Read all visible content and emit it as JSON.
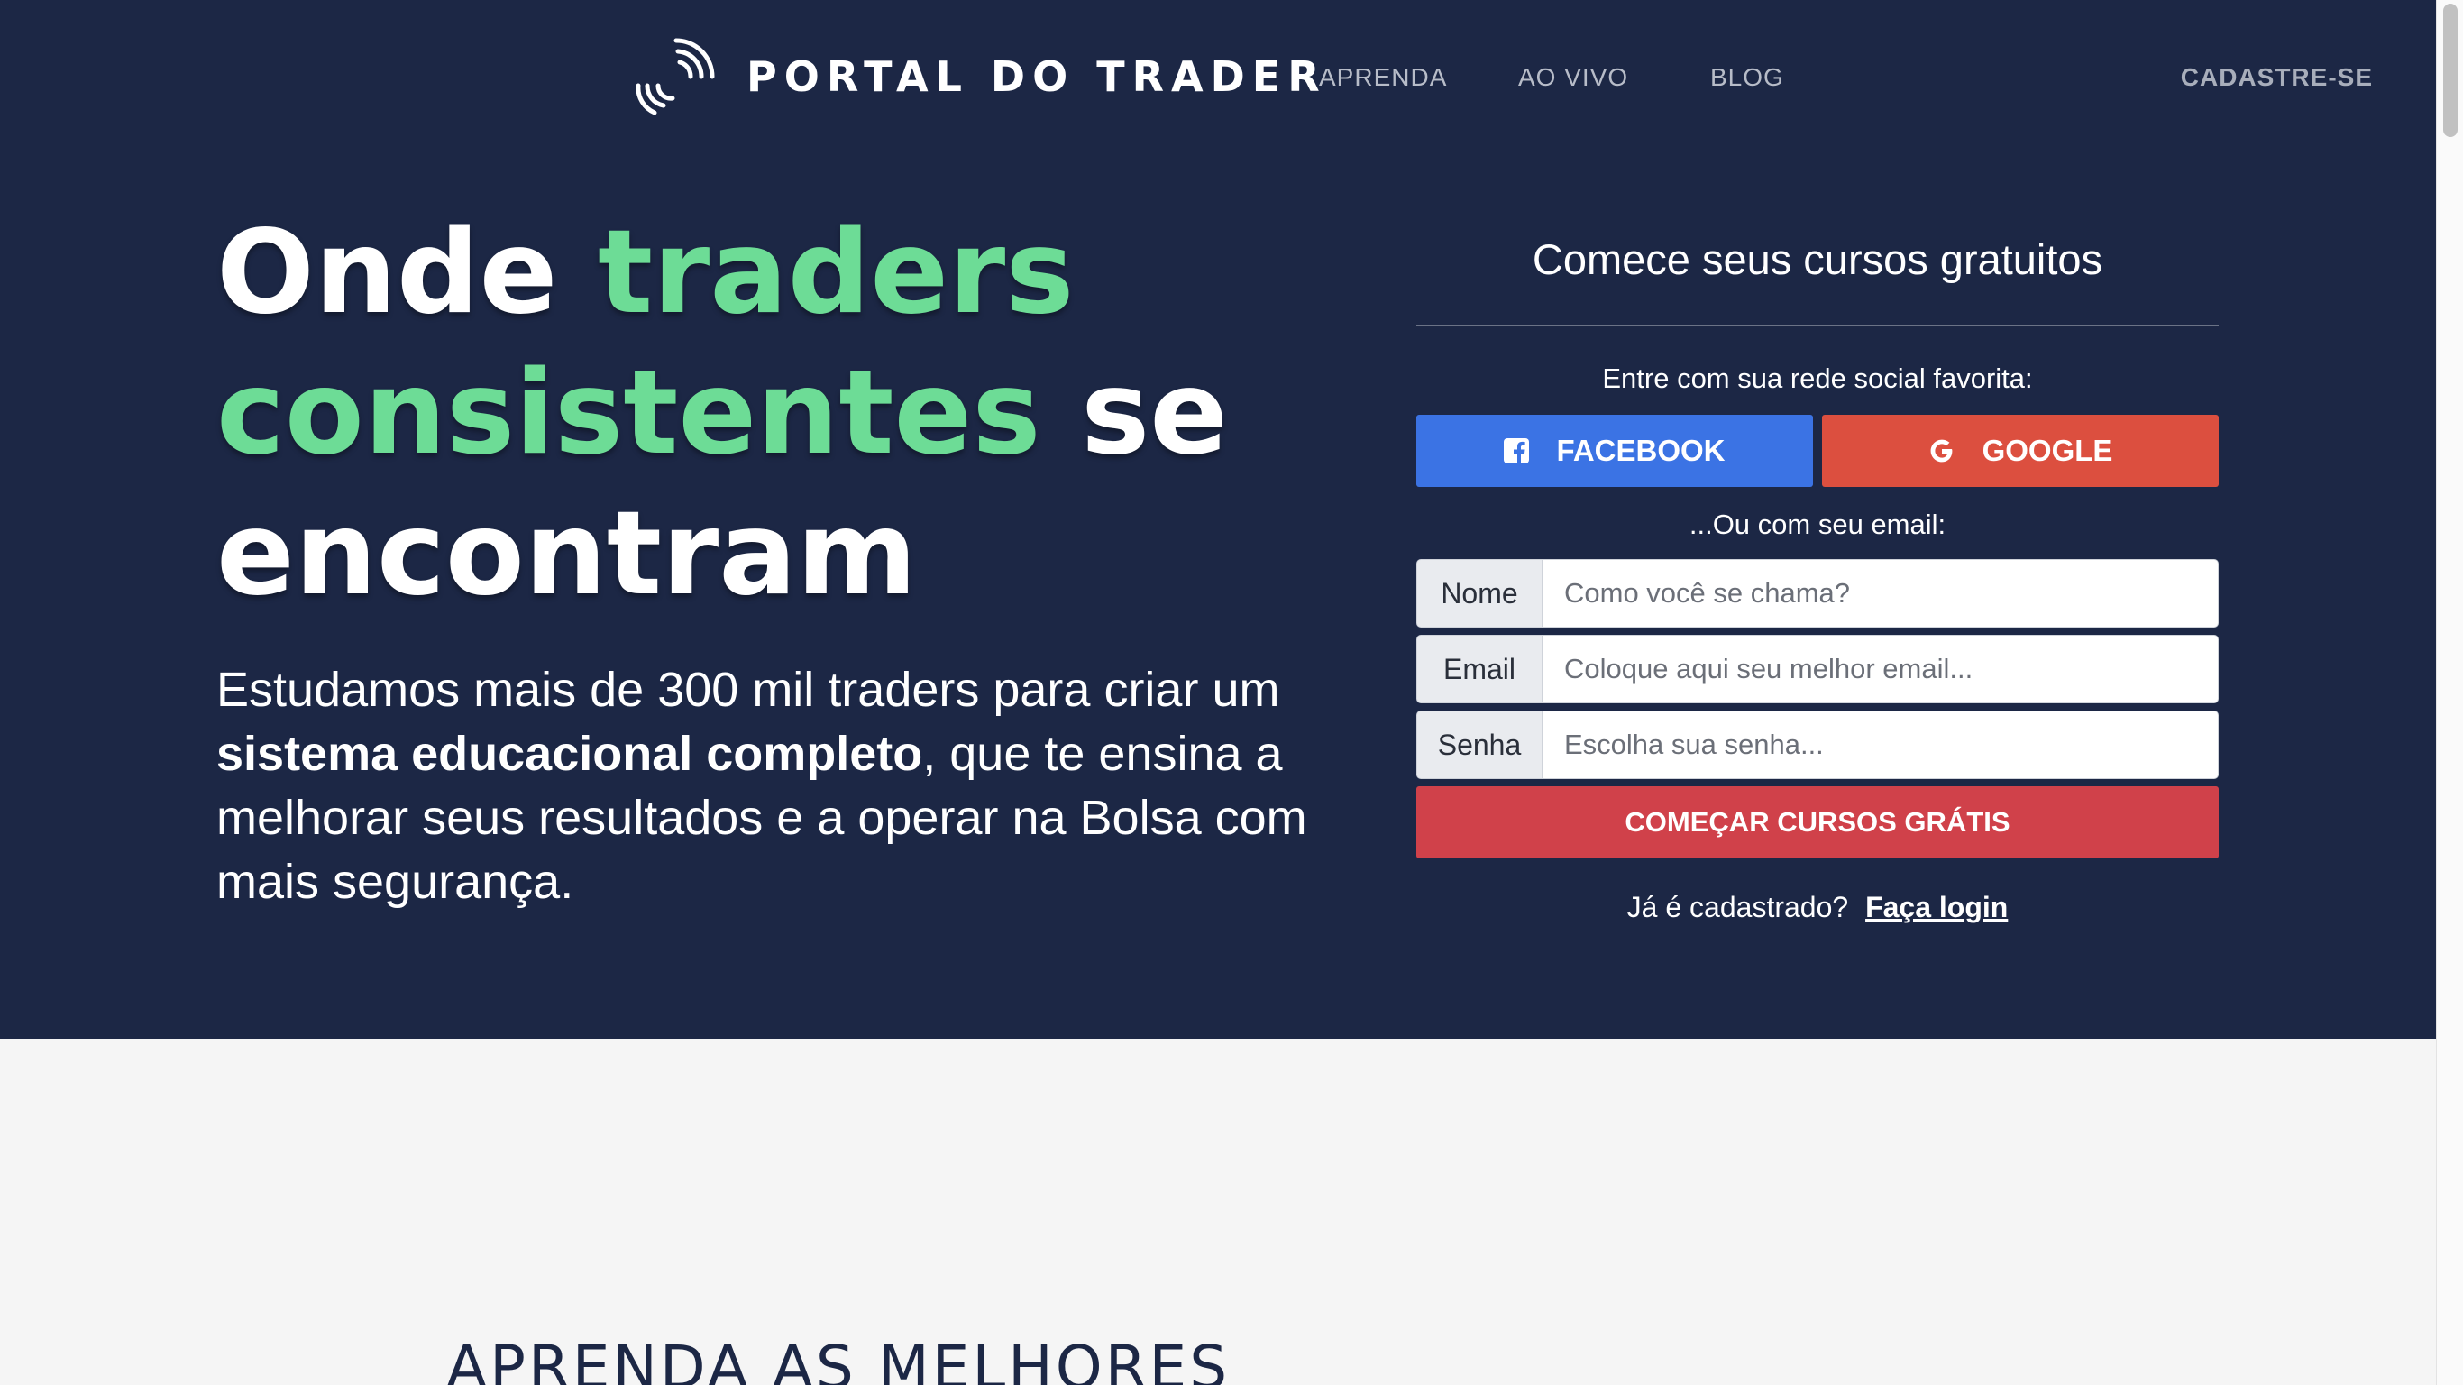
{
  "header": {
    "logo_text": "PORTAL DO TRADER",
    "logo_icon": "signal-waves-icon",
    "nav": [
      "APRENDA",
      "AO VIVO",
      "BLOG"
    ],
    "signup": "CADASTRE-SE"
  },
  "hero": {
    "headline": {
      "part1": "Onde ",
      "part2": "traders",
      "part3": "consistentes",
      "part4": " se",
      "part5": "encontram"
    },
    "subtext": {
      "part1": "Estudamos mais de 300 mil traders para criar um ",
      "bold": "sistema educacional completo",
      "part2": ", que te ensina a melhorar seus resultados e a operar na Bolsa com mais segurança."
    }
  },
  "form": {
    "title": "Comece seus cursos gratuitos",
    "social_label": "Entre com sua rede social favorita:",
    "facebook": "FACEBOOK",
    "google": "GOOGLE",
    "email_label": "...Ou com seu email:",
    "fields": [
      {
        "label": "Nome",
        "placeholder": "Como você se chama?"
      },
      {
        "label": "Email",
        "placeholder": "Coloque aqui seu melhor email..."
      },
      {
        "label": "Senha",
        "placeholder": "Escolha sua senha..."
      }
    ],
    "submit": "COMEÇAR CURSOS GRÁTIS",
    "login_prompt": "Já é cadastrado?",
    "login_link": "Faça login"
  },
  "section": {
    "title": "APRENDA AS MELHORES"
  },
  "colors": {
    "navy": "#1c2745",
    "accent_green": "#6ddc96",
    "facebook_blue": "#3b73e4",
    "google_red": "#dc4f3f",
    "submit_red": "#d0414a"
  }
}
